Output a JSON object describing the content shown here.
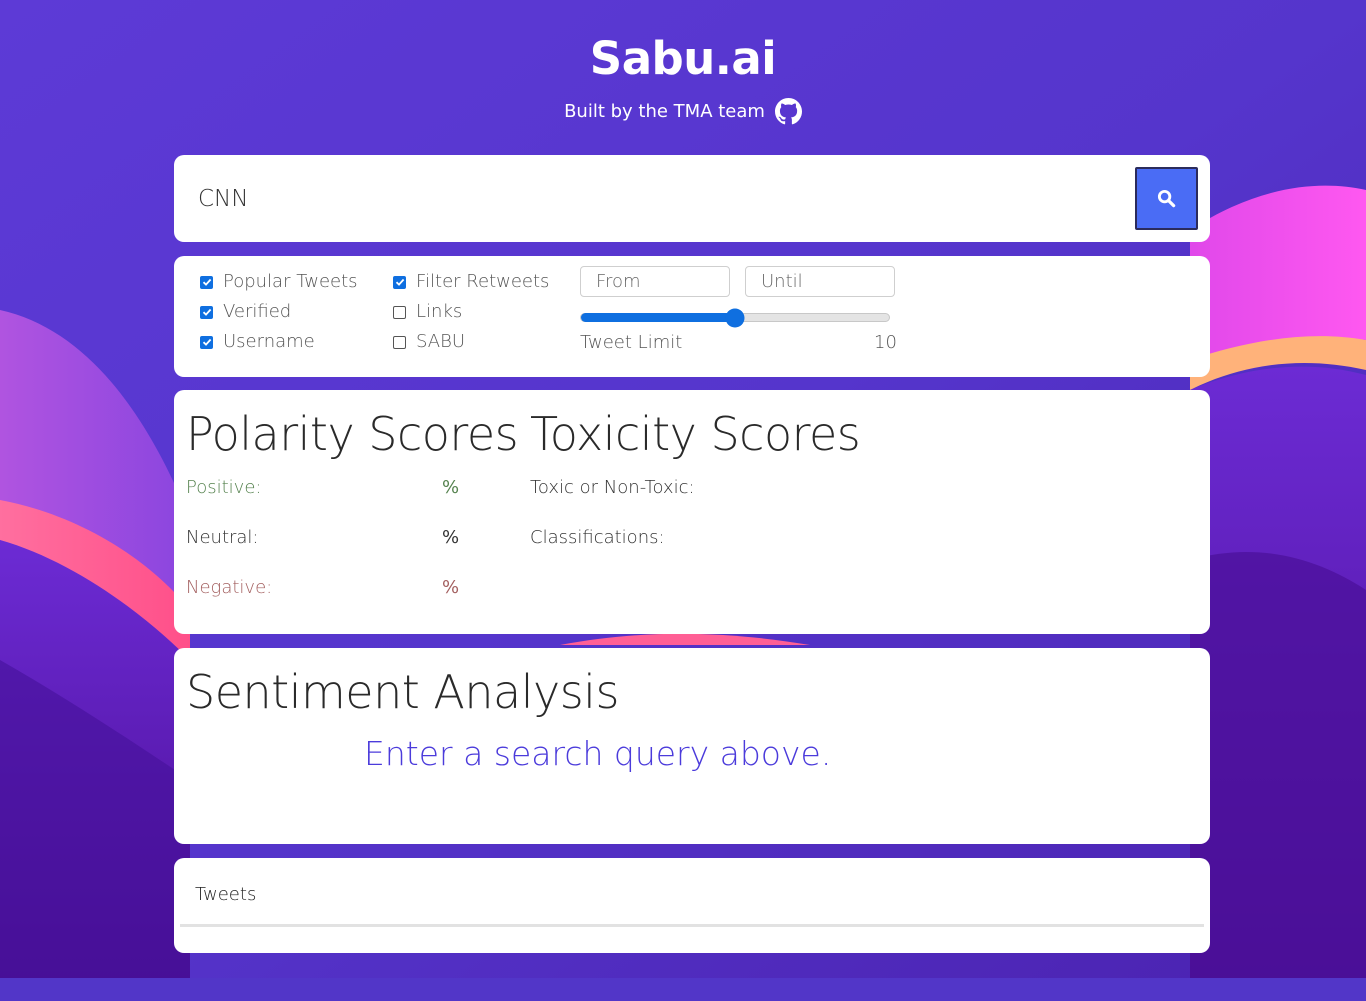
{
  "header": {
    "brand": "Sabu.ai",
    "byline": "Built by the TMA team",
    "github_icon": "github-icon"
  },
  "search": {
    "value": "CNN",
    "button_icon": "search-icon",
    "accent": "#4a6cf5"
  },
  "filters": {
    "checkboxes": [
      {
        "label": "Popular Tweets",
        "checked": true
      },
      {
        "label": "Verified",
        "checked": true
      },
      {
        "label": "Username",
        "checked": true
      },
      {
        "label": "Filter Retweets",
        "checked": true
      },
      {
        "label": "Links",
        "checked": false
      },
      {
        "label": "SABU",
        "checked": false
      }
    ],
    "from_placeholder": "From",
    "until_placeholder": "Until",
    "slider_label": "Tweet Limit",
    "slider_value": "10",
    "slider_fraction": 0.5
  },
  "polarity": {
    "title": "Polarity Scores",
    "positive_label": "Positive:",
    "positive_pct": "%",
    "neutral_label": "Neutral:",
    "neutral_pct": "%",
    "negative_label": "Negative:",
    "negative_pct": "%"
  },
  "toxicity": {
    "title": "Toxicity Scores",
    "toxic_label": "Toxic or Non-Toxic:",
    "class_label": "Classifications:"
  },
  "sentiment": {
    "title": "Sentiment Analysis",
    "hint": "Enter a search query above."
  },
  "tweets": {
    "title": "Tweets"
  },
  "colors": {
    "background": "#5538cf",
    "checkbox_blue": "#0f6fe0",
    "positive": "#55824e",
    "negative": "#a35f5f",
    "hint": "#4b3bdb"
  }
}
